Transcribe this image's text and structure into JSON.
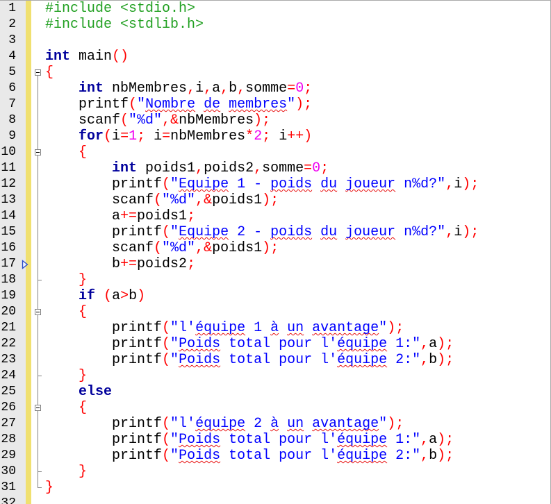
{
  "editor": {
    "colors": {
      "preprocessor": "#22a022",
      "keyword": "#00009c",
      "identifier": "#000000",
      "operator": "#ff0000",
      "number": "#f000f0",
      "string": "#0000ff",
      "spell_error": "#e81010",
      "gutter": "#e9e9e9",
      "change_bar": "#f0e070",
      "fold_line": "#808080",
      "marker": "#2a4bc8"
    }
  },
  "lines": [
    {
      "num": "1",
      "t": [
        {
          "p": "#include <stdio.h>"
        }
      ]
    },
    {
      "num": "2",
      "t": [
        {
          "p": "#include <stdlib.h>"
        }
      ]
    },
    {
      "num": "3",
      "t": []
    },
    {
      "num": "4",
      "t": [
        {
          "k": "int"
        },
        {
          "i": " main"
        },
        {
          "o": "()"
        }
      ]
    },
    {
      "num": "5",
      "fold": "fold-collapse-icon",
      "t": [
        {
          "o": "{"
        }
      ]
    },
    {
      "num": "6",
      "t": [
        {
          "i": "    "
        },
        {
          "k": "int"
        },
        {
          "i": " nbMembres"
        },
        {
          "o": ","
        },
        {
          "i": "i"
        },
        {
          "o": ","
        },
        {
          "i": "a"
        },
        {
          "o": ","
        },
        {
          "i": "b"
        },
        {
          "o": ","
        },
        {
          "i": "somme"
        },
        {
          "o": "="
        },
        {
          "n": "0"
        },
        {
          "o": ";"
        }
      ]
    },
    {
      "num": "7",
      "t": [
        {
          "i": "    printf"
        },
        {
          "o": "("
        },
        {
          "s": "\""
        },
        {
          "e": "Nombre"
        },
        {
          "s": " "
        },
        {
          "e": "de"
        },
        {
          "s": " "
        },
        {
          "e": "membres"
        },
        {
          "s": "\""
        },
        {
          "o": ");"
        }
      ]
    },
    {
      "num": "8",
      "t": [
        {
          "i": "    scanf"
        },
        {
          "o": "("
        },
        {
          "s": "\"%d\""
        },
        {
          "o": ",&"
        },
        {
          "i": "nbMembres"
        },
        {
          "o": ");"
        }
      ]
    },
    {
      "num": "9",
      "t": [
        {
          "i": "    "
        },
        {
          "k": "for"
        },
        {
          "o": "("
        },
        {
          "i": "i"
        },
        {
          "o": "="
        },
        {
          "n": "1"
        },
        {
          "o": ";"
        },
        {
          "i": " i"
        },
        {
          "o": "="
        },
        {
          "i": "nbMembres"
        },
        {
          "o": "*"
        },
        {
          "n": "2"
        },
        {
          "o": ";"
        },
        {
          "i": " i"
        },
        {
          "o": "++)"
        }
      ]
    },
    {
      "num": "10",
      "fold": "fold-collapse-icon",
      "t": [
        {
          "i": "    "
        },
        {
          "o": "{"
        }
      ]
    },
    {
      "num": "11",
      "t": [
        {
          "i": "        "
        },
        {
          "k": "int"
        },
        {
          "i": " poids1"
        },
        {
          "o": ","
        },
        {
          "i": "poids2"
        },
        {
          "o": ","
        },
        {
          "i": "somme"
        },
        {
          "o": "="
        },
        {
          "n": "0"
        },
        {
          "o": ";"
        }
      ]
    },
    {
      "num": "12",
      "t": [
        {
          "i": "        printf"
        },
        {
          "o": "("
        },
        {
          "s": "\""
        },
        {
          "e": "Equipe"
        },
        {
          "s": " 1 - "
        },
        {
          "e": "poids"
        },
        {
          "s": " "
        },
        {
          "e": "du"
        },
        {
          "s": " "
        },
        {
          "e": "joueur"
        },
        {
          "s": " n%d?\""
        },
        {
          "o": ","
        },
        {
          "i": "i"
        },
        {
          "o": ");"
        }
      ]
    },
    {
      "num": "13",
      "t": [
        {
          "i": "        scanf"
        },
        {
          "o": "("
        },
        {
          "s": "\"%d\""
        },
        {
          "o": ",&"
        },
        {
          "i": "poids1"
        },
        {
          "o": ");"
        }
      ]
    },
    {
      "num": "14",
      "t": [
        {
          "i": "        a"
        },
        {
          "o": "+="
        },
        {
          "i": "poids1"
        },
        {
          "o": ";"
        }
      ]
    },
    {
      "num": "15",
      "t": [
        {
          "i": "        printf"
        },
        {
          "o": "("
        },
        {
          "s": "\""
        },
        {
          "e": "Equipe"
        },
        {
          "s": " 2 - "
        },
        {
          "e": "poids"
        },
        {
          "s": " "
        },
        {
          "e": "du"
        },
        {
          "s": " "
        },
        {
          "e": "joueur"
        },
        {
          "s": " n%d?\""
        },
        {
          "o": ","
        },
        {
          "i": "i"
        },
        {
          "o": ");"
        }
      ]
    },
    {
      "num": "16",
      "t": [
        {
          "i": "        scanf"
        },
        {
          "o": "("
        },
        {
          "s": "\"%d\""
        },
        {
          "o": ",&"
        },
        {
          "i": "poids1"
        },
        {
          "o": ");"
        }
      ]
    },
    {
      "num": "17",
      "marker": "triangle-right-icon",
      "t": [
        {
          "i": "        b"
        },
        {
          "o": "+="
        },
        {
          "i": "poids2"
        },
        {
          "o": ";"
        }
      ]
    },
    {
      "num": "18",
      "fold": "fold-end-icon",
      "t": [
        {
          "i": "    "
        },
        {
          "o": "}"
        }
      ]
    },
    {
      "num": "19",
      "t": [
        {
          "i": "    "
        },
        {
          "k": "if"
        },
        {
          "i": " "
        },
        {
          "o": "("
        },
        {
          "i": "a"
        },
        {
          "o": ">"
        },
        {
          "i": "b"
        },
        {
          "o": ")"
        }
      ]
    },
    {
      "num": "20",
      "fold": "fold-collapse-icon",
      "t": [
        {
          "i": "    "
        },
        {
          "o": "{"
        }
      ]
    },
    {
      "num": "21",
      "t": [
        {
          "i": "        printf"
        },
        {
          "o": "("
        },
        {
          "s": "\"l'"
        },
        {
          "e": "équipe"
        },
        {
          "s": " 1 "
        },
        {
          "e": "à"
        },
        {
          "s": " "
        },
        {
          "e": "un"
        },
        {
          "s": " "
        },
        {
          "e": "avantage"
        },
        {
          "s": "\""
        },
        {
          "o": ");"
        }
      ]
    },
    {
      "num": "22",
      "t": [
        {
          "i": "        printf"
        },
        {
          "o": "("
        },
        {
          "s": "\""
        },
        {
          "e": "Poids"
        },
        {
          "s": " total pour l'"
        },
        {
          "e": "équipe"
        },
        {
          "s": " 1:\""
        },
        {
          "o": ","
        },
        {
          "i": "a"
        },
        {
          "o": ");"
        }
      ]
    },
    {
      "num": "23",
      "t": [
        {
          "i": "        printf"
        },
        {
          "o": "("
        },
        {
          "s": "\""
        },
        {
          "e": "Poids"
        },
        {
          "s": " total pour l'"
        },
        {
          "e": "équipe"
        },
        {
          "s": " 2:\""
        },
        {
          "o": ","
        },
        {
          "i": "b"
        },
        {
          "o": ");"
        }
      ]
    },
    {
      "num": "24",
      "fold": "fold-end-icon",
      "t": [
        {
          "i": "    "
        },
        {
          "o": "}"
        }
      ]
    },
    {
      "num": "25",
      "t": [
        {
          "i": "    "
        },
        {
          "k": "else"
        }
      ]
    },
    {
      "num": "26",
      "fold": "fold-collapse-icon",
      "t": [
        {
          "i": "    "
        },
        {
          "o": "{"
        }
      ]
    },
    {
      "num": "27",
      "t": [
        {
          "i": "        printf"
        },
        {
          "o": "("
        },
        {
          "s": "\"l'"
        },
        {
          "e": "équipe"
        },
        {
          "s": " 2 "
        },
        {
          "e": "à"
        },
        {
          "s": " "
        },
        {
          "e": "un"
        },
        {
          "s": " "
        },
        {
          "e": "avantage"
        },
        {
          "s": "\""
        },
        {
          "o": ");"
        }
      ]
    },
    {
      "num": "28",
      "t": [
        {
          "i": "        printf"
        },
        {
          "o": "("
        },
        {
          "s": "\""
        },
        {
          "e": "Poids"
        },
        {
          "s": " total pour l'"
        },
        {
          "e": "équipe"
        },
        {
          "s": " 1:\""
        },
        {
          "o": ","
        },
        {
          "i": "a"
        },
        {
          "o": ");"
        }
      ]
    },
    {
      "num": "29",
      "t": [
        {
          "i": "        printf"
        },
        {
          "o": "("
        },
        {
          "s": "\""
        },
        {
          "e": "Poids"
        },
        {
          "s": " total pour l'"
        },
        {
          "e": "équipe"
        },
        {
          "s": " 2:\""
        },
        {
          "o": ","
        },
        {
          "i": "b"
        },
        {
          "o": ");"
        }
      ]
    },
    {
      "num": "30",
      "fold": "fold-end-icon",
      "t": [
        {
          "i": "    "
        },
        {
          "o": "}"
        }
      ]
    },
    {
      "num": "31",
      "fold": "fold-end-icon",
      "t": [
        {
          "o": "}"
        }
      ]
    },
    {
      "num": "32",
      "t": []
    }
  ]
}
